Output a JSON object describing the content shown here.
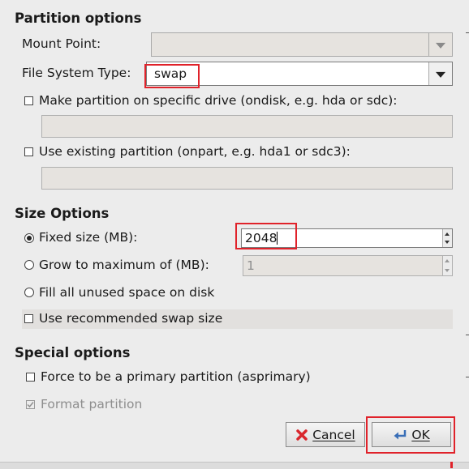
{
  "partition_options": {
    "title": "Partition options",
    "mount_point_label": "Mount Point:",
    "mount_point_value": "",
    "fs_type_label": "File System Type:",
    "fs_type_value": "swap",
    "ondisk_label": "Make partition on specific drive (ondisk, e.g. hda or sdc):",
    "ondisk_value": "",
    "onpart_label": "Use existing partition (onpart, e.g. hda1 or sdc3):",
    "onpart_value": ""
  },
  "size_options": {
    "title": "Size Options",
    "fixed_label": "Fixed size (MB):",
    "fixed_value": "2048",
    "grow_label": "Grow to maximum of (MB):",
    "grow_value": "1",
    "fill_label": "Fill all unused space on disk",
    "recommended_swap_label": "Use recommended swap size"
  },
  "special_options": {
    "title": "Special options",
    "primary_label": "Force to be a primary partition (asprimary)",
    "format_label": "Format partition"
  },
  "buttons": {
    "cancel_label": "Cancel",
    "ok_label": "OK"
  },
  "colors": {
    "highlight": "#e0222a",
    "cancel_icon": "#d9262c",
    "ok_icon": "#3a6fb7"
  }
}
